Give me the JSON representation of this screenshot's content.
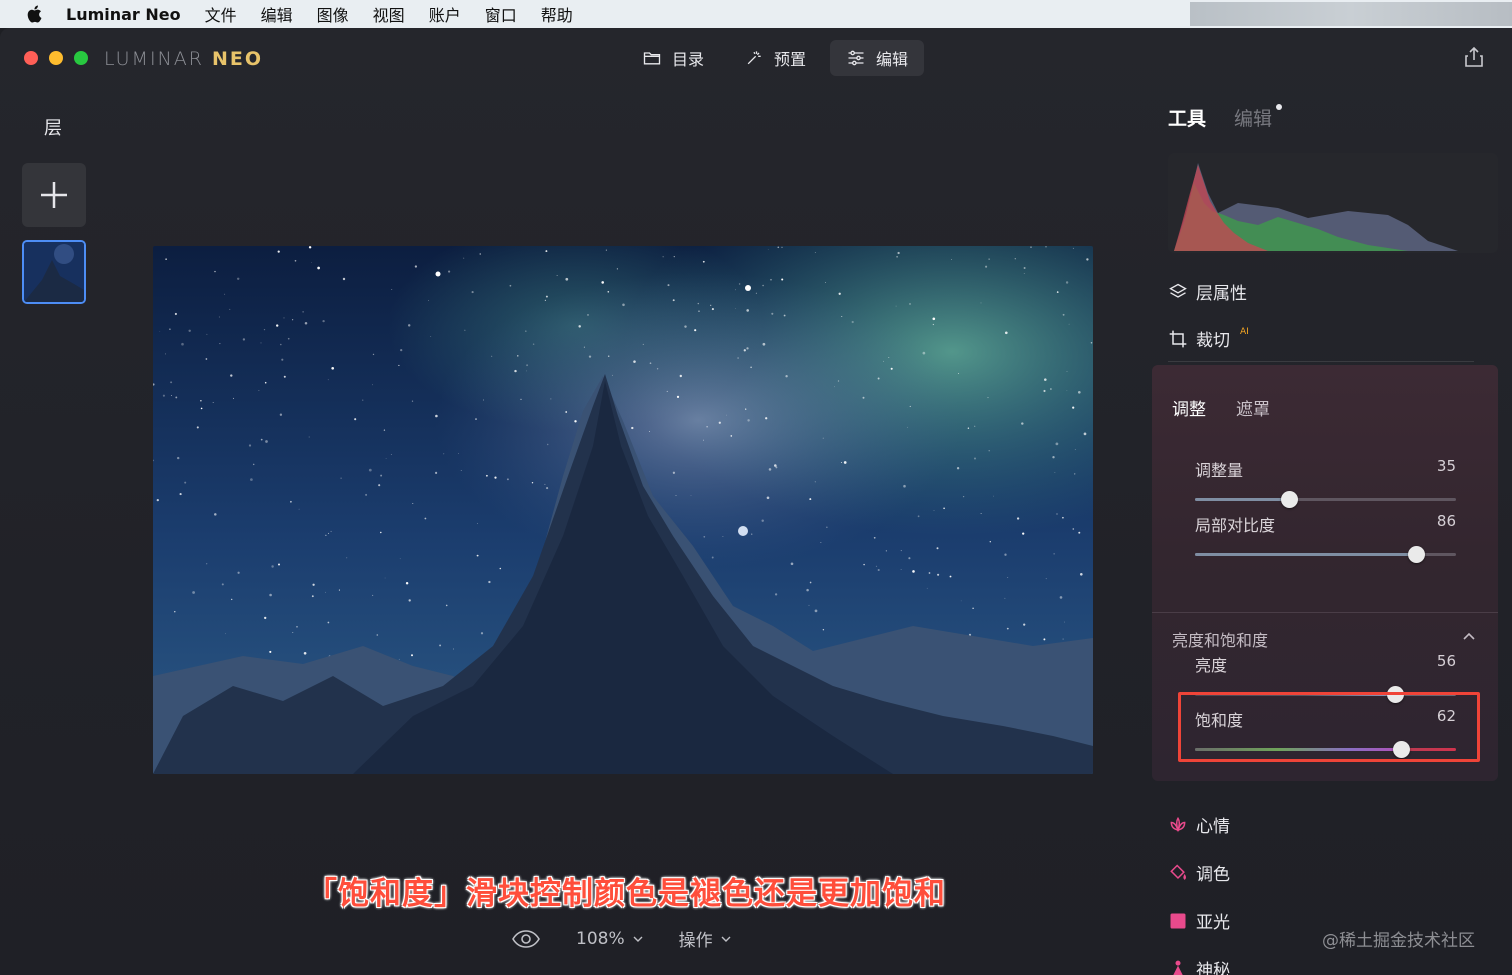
{
  "menubar": {
    "app_name": "Luminar Neo",
    "items": [
      "文件",
      "编辑",
      "图像",
      "视图",
      "账户",
      "窗口",
      "帮助"
    ]
  },
  "window": {
    "brand_left": "LUMINAR ",
    "brand_right": "NEO",
    "nav": [
      {
        "label": "目录",
        "icon": "folder-icon"
      },
      {
        "label": "预置",
        "icon": "magic-wand-icon"
      },
      {
        "label": "编辑",
        "icon": "sliders-icon",
        "active": true
      }
    ]
  },
  "layers": {
    "title": "层"
  },
  "right_panel": {
    "tabs": {
      "tools": "工具",
      "edit": "编辑"
    },
    "layer_properties": "层属性",
    "crop": "裁切",
    "crop_badge": "AI",
    "tool": {
      "subtabs": {
        "adjust": "调整",
        "mask": "遮罩"
      },
      "sliders_top": [
        {
          "label": "调整量",
          "value": "35",
          "fraction": 0.36
        },
        {
          "label": "局部对比度",
          "value": "86",
          "fraction": 0.845
        }
      ],
      "section_title": "亮度和饱和度",
      "sliders_bottom": [
        {
          "label": "亮度",
          "value": "56",
          "fraction": 0.765
        },
        {
          "label": "饱和度",
          "value": "62",
          "fraction": 0.79
        }
      ]
    },
    "tools_list": [
      {
        "label": "心情",
        "icon": "lotus-icon",
        "color": "#e94a8c"
      },
      {
        "label": "调色",
        "icon": "paint-bucket-icon",
        "color": "#e94a8c"
      },
      {
        "label": "亚光",
        "icon": "square-icon",
        "color": "#e94a8c"
      },
      {
        "label": "神秘",
        "icon": "figure-icon",
        "color": "#e94a8c"
      }
    ]
  },
  "canvas": {
    "caption": "「饱和度」滑块控制颜色是褪色还是更加饱和",
    "zoom": "108%",
    "actions": "操作"
  },
  "watermark": "@稀土掘金技术社区"
}
